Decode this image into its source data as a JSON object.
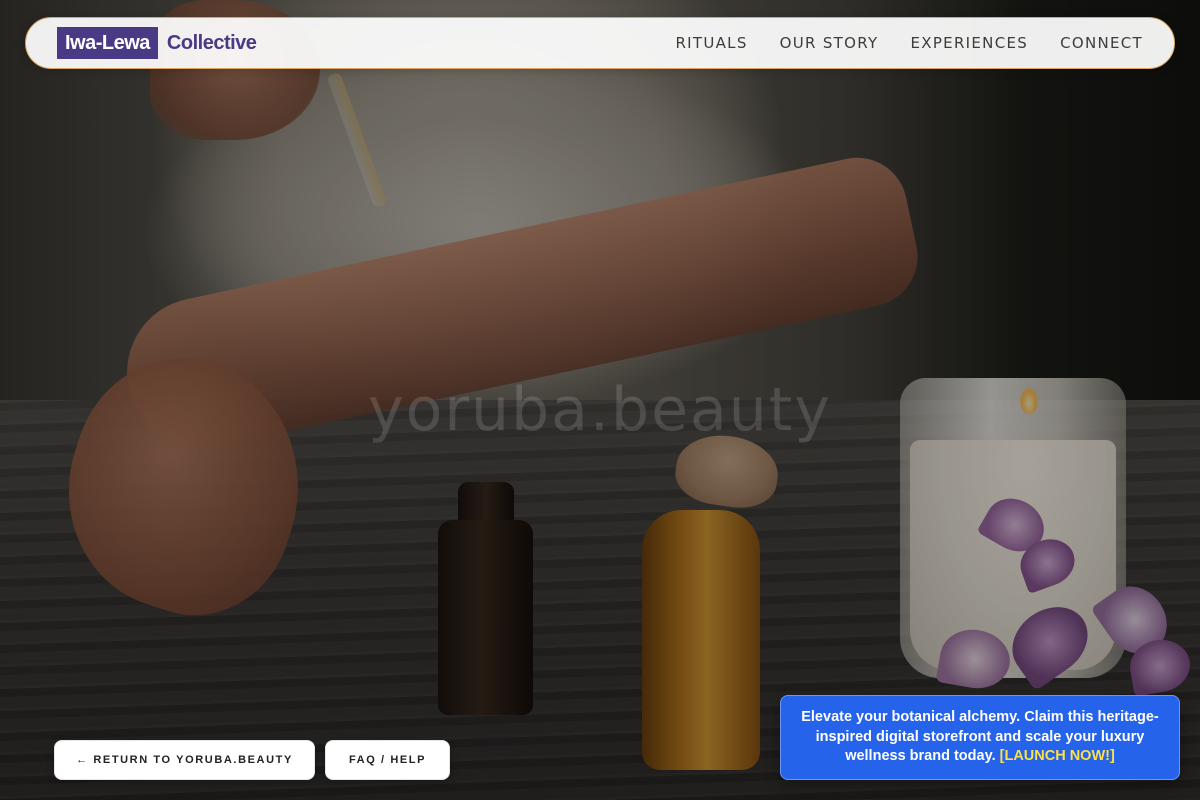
{
  "brand": {
    "logo_box": "Iwa-Lewa",
    "logo_text": "Collective",
    "accent_color": "#4a3a86",
    "border_color": "#d9a45f"
  },
  "nav": {
    "items": [
      {
        "label": "RITUALS"
      },
      {
        "label": "OUR STORY"
      },
      {
        "label": "EXPERIENCES"
      },
      {
        "label": "CONNECT"
      }
    ]
  },
  "watermark": "yoruba.beauty",
  "footer": {
    "return_label": "← RETURN TO YORUBA.BEAUTY",
    "faq_label": "FAQ / HELP"
  },
  "promo": {
    "text": "Elevate your botanical alchemy. Claim this heritage-inspired digital storefront and scale your luxury wellness brand today.",
    "cta": "[LAUNCH NOW!]",
    "background": "#2563eb",
    "cta_color": "#fde047"
  }
}
